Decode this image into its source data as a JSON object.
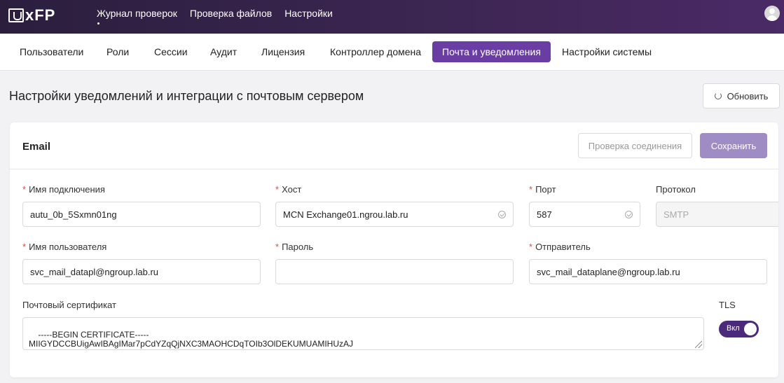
{
  "app": {
    "logo_text": "xFP"
  },
  "topnav": [
    {
      "label": "Журнал проверок"
    },
    {
      "label": "Проверка файлов"
    },
    {
      "label": "Настройки"
    }
  ],
  "subtabs": [
    {
      "label": "Пользователи"
    },
    {
      "label": "Роли"
    },
    {
      "label": "Сессии"
    },
    {
      "label": "Аудит"
    },
    {
      "label": "Лицензия"
    },
    {
      "label": "Контроллер домена"
    },
    {
      "label": "Почта и уведомления",
      "active": true
    },
    {
      "label": "Настройки системы"
    }
  ],
  "page": {
    "title": "Настройки уведомлений и интеграции с почтовым сервером",
    "refresh_label": "Обновить"
  },
  "card": {
    "title": "Email",
    "check_label": "Проверка соединения",
    "save_label": "Сохранить"
  },
  "form": {
    "required_mark": "*",
    "connection_name": {
      "label": "Имя подключения",
      "value": "autu_0b_5Sxmn01ng"
    },
    "host": {
      "label": "Хост",
      "value": "MCN Exchange01.ngrou.lab.ru"
    },
    "port": {
      "label": "Порт",
      "value": "587"
    },
    "protocol": {
      "label": "Протокол",
      "value": "SMTP"
    },
    "username": {
      "label": "Имя пользователя",
      "value": "svc_mail_datapl@ngroup.lab.ru"
    },
    "password": {
      "label": "Пароль",
      "value": ""
    },
    "sender": {
      "label": "Отправитель",
      "value": "svc_mail_dataplane@ngroup.lab.ru"
    },
    "certificate": {
      "label": "Почтовый сертификат",
      "value": "-----BEGIN CERTIFICATE-----\nMIIGYDCCBUigAwIBAgIMar7pCdYZqQjNXC3MAOHCDqTOIb3OlDEKUMUAMIHUzAJ"
    },
    "tls": {
      "label": "TLS",
      "toggle_label": "Вкл",
      "enabled": true
    }
  },
  "colors": {
    "accent": "#6a3da4",
    "toggle_on": "#4b2a7b",
    "save_button": "#a08cc4"
  }
}
